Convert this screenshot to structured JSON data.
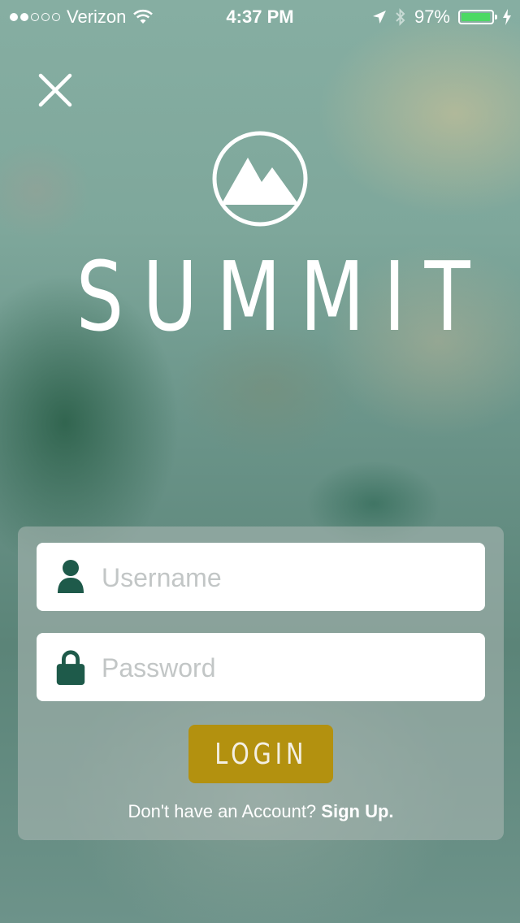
{
  "status_bar": {
    "carrier": "Verizon",
    "signal_bars_filled": 2,
    "signal_bars_total": 5,
    "time": "4:37 PM",
    "battery_percent_label": "97%",
    "battery_level": 0.97,
    "battery_color": "#4cd964"
  },
  "header": {
    "close_icon": "close-icon",
    "logo_icon": "mountain-logo-icon",
    "app_name": "SUMMIT"
  },
  "login_form": {
    "username": {
      "placeholder": "Username",
      "value": "",
      "icon": "user-icon"
    },
    "password": {
      "placeholder": "Password",
      "value": "",
      "icon": "lock-icon"
    },
    "login_button_label": "LOGIN",
    "signup_prompt": "Don't have an Account?",
    "signup_link": "Sign Up."
  },
  "colors": {
    "accent_gold": "#b3910f",
    "icon_green": "#1e5a4a",
    "overlay_teal": "#7fa79c"
  }
}
